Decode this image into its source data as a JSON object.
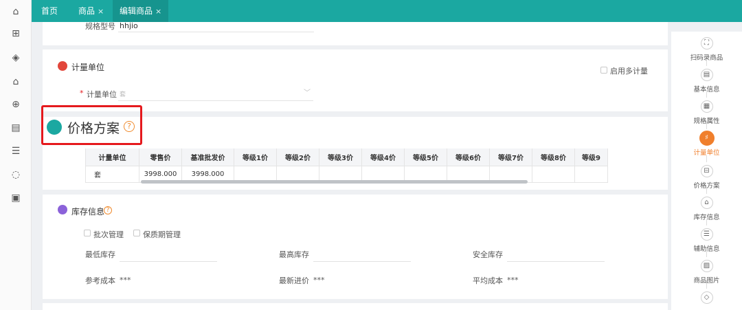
{
  "tabs": [
    {
      "label": "首页",
      "closable": false
    },
    {
      "label": "商品",
      "closable": true
    },
    {
      "label": "编辑商品",
      "closable": true,
      "active": true
    }
  ],
  "tab_close_glyph": "×",
  "left_icons": [
    "home-icon",
    "gift-icon",
    "tag-icon",
    "store-icon",
    "bag-icon",
    "clipboard-icon",
    "report-icon",
    "loading-icon",
    "document-icon"
  ],
  "spec": {
    "label": "规格型号",
    "value": "hhjio"
  },
  "unit_section": {
    "title": "计量单位",
    "multi_unit_label": "启用多计量",
    "required_mark": "*",
    "field_label": "计量单位",
    "field_value": "套"
  },
  "price_section": {
    "title": "价格方案",
    "help": "?",
    "columns": [
      "计量单位",
      "零售价",
      "基准批发价",
      "等级1价",
      "等级2价",
      "等级3价",
      "等级4价",
      "等级5价",
      "等级6价",
      "等级7价",
      "等级8价",
      "等级9"
    ],
    "row": [
      "套",
      "3998.000",
      "3998.000",
      "",
      "",
      "",
      "",
      "",
      "",
      "",
      "",
      ""
    ]
  },
  "stock_section": {
    "title": "库存信息",
    "help": "?",
    "batch_label": "批次管理",
    "shelf_label": "保质期管理",
    "min_stock": "最低库存",
    "max_stock": "最高库存",
    "safe_stock": "安全库存",
    "ref_cost": "参考成本",
    "ref_cost_val": "***",
    "latest_price": "最新进价",
    "latest_price_val": "***",
    "avg_cost": "平均成本",
    "avg_cost_val": "***"
  },
  "right_nav": [
    {
      "label": "扫码录商品",
      "icon": "scan-icon"
    },
    {
      "label": "基本信息",
      "icon": "info-icon"
    },
    {
      "label": "规格属性",
      "icon": "grid-icon"
    },
    {
      "label": "计量单位",
      "icon": "unit-icon",
      "active": true
    },
    {
      "label": "价格方案",
      "icon": "price-icon"
    },
    {
      "label": "库存信息",
      "icon": "stock-icon"
    },
    {
      "label": "辅助信息",
      "icon": "aux-icon"
    },
    {
      "label": "商品图片",
      "icon": "image-icon"
    },
    {
      "label": "",
      "icon": "tag-icon"
    }
  ],
  "colors": {
    "topbar": "#1ba8a1",
    "accent": "#f07f2c",
    "highlight": "#e5191d"
  }
}
